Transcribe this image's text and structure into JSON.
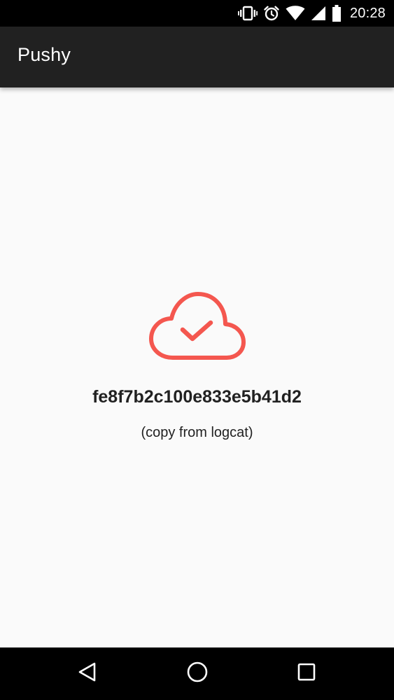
{
  "status_bar": {
    "time": "20:28",
    "icons": [
      "vibrate-icon",
      "alarm-icon",
      "wifi-icon",
      "cell-signal-icon",
      "battery-icon"
    ]
  },
  "app_bar": {
    "title": "Pushy"
  },
  "main": {
    "icon": "cloud-check-icon",
    "device_token": "fe8f7b2c100e833e5b41d2",
    "hint": "(copy from logcat)"
  },
  "nav_bar": {
    "buttons": [
      "back-icon",
      "home-icon",
      "recents-icon"
    ]
  },
  "colors": {
    "status_bar_bg": "#000000",
    "app_bar_bg": "#212121",
    "content_bg": "#fafafa",
    "accent": "#f4574f",
    "text": "#212121",
    "nav_bar_bg": "#000000"
  }
}
